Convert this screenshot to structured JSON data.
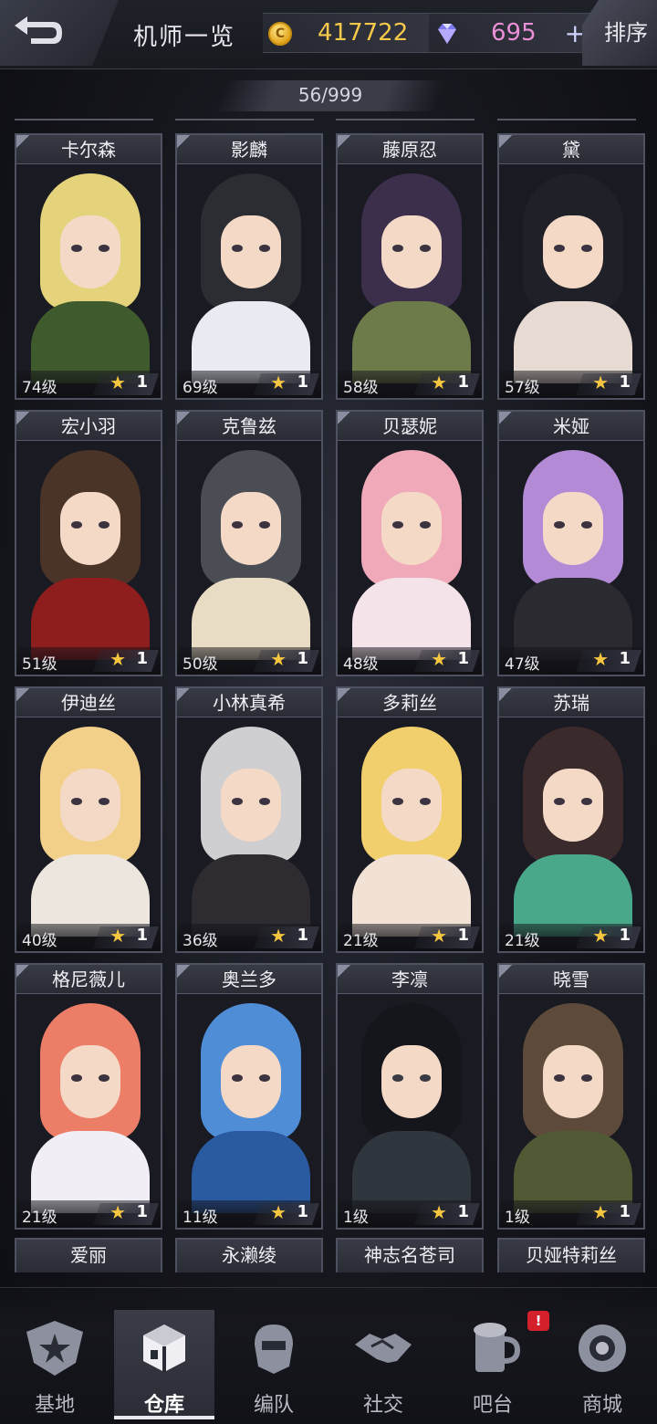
{
  "header": {
    "title": "机师一览",
    "coins": "417722",
    "gems": "695",
    "plus": "+",
    "sort_label": "排序",
    "coin_glyph": "C"
  },
  "count": "56/999",
  "pilots": [
    {
      "name": "卡尔森",
      "level": "74级",
      "rank": "1",
      "hair": "#e4d37a",
      "outfit": "#3f5a2c"
    },
    {
      "name": "影麟",
      "level": "69级",
      "rank": "1",
      "hair": "#2b2d33",
      "outfit": "#e8ecf2"
    },
    {
      "name": "藤原忍",
      "level": "58级",
      "rank": "1",
      "hair": "#3b2f4c",
      "outfit": "#6d7a49"
    },
    {
      "name": "黛",
      "level": "57级",
      "rank": "1",
      "hair": "#1f2028",
      "outfit": "#e6dad2"
    },
    {
      "name": "宏小羽",
      "level": "51级",
      "rank": "1",
      "hair": "#4a3327",
      "outfit": "#8e1d1d"
    },
    {
      "name": "克鲁兹",
      "level": "50级",
      "rank": "1",
      "hair": "#4b4d54",
      "outfit": "#e8dcc4"
    },
    {
      "name": "贝瑟妮",
      "level": "48级",
      "rank": "1",
      "hair": "#f0a9b8",
      "outfit": "#f4e4ea"
    },
    {
      "name": "米娅",
      "level": "47级",
      "rank": "1",
      "hair": "#b28ad6",
      "outfit": "#2b2a31"
    },
    {
      "name": "伊迪丝",
      "level": "40级",
      "rank": "1",
      "hair": "#f2d08a",
      "outfit": "#ece6de"
    },
    {
      "name": "小林真希",
      "level": "36级",
      "rank": "1",
      "hair": "#cfcfd2",
      "outfit": "#2e2c31"
    },
    {
      "name": "多莉丝",
      "level": "21级",
      "rank": "1",
      "hair": "#f0cf6c",
      "outfit": "#f2e2d6"
    },
    {
      "name": "苏瑞",
      "level": "21级",
      "rank": "1",
      "hair": "#3b2a2c",
      "outfit": "#4aa88a"
    },
    {
      "name": "格尼薇儿",
      "level": "21级",
      "rank": "1",
      "hair": "#ec7d66",
      "outfit": "#f2eef6"
    },
    {
      "name": "奥兰多",
      "level": "11级",
      "rank": "1",
      "hair": "#4f8ed6",
      "outfit": "#2a5aa0"
    },
    {
      "name": "李凛",
      "level": "1级",
      "rank": "1",
      "hair": "#15161b",
      "outfit": "#30363e"
    },
    {
      "name": "晓雪",
      "level": "1级",
      "rank": "1",
      "hair": "#5e4a3a",
      "outfit": "#4f5a35"
    }
  ],
  "partial_pilots": [
    "爱丽",
    "永濑绫",
    "神志名苍司",
    "贝娅特莉丝"
  ],
  "nav": [
    {
      "label": "基地",
      "icon": "base-icon"
    },
    {
      "label": "仓库",
      "icon": "warehouse-icon"
    },
    {
      "label": "编队",
      "icon": "squad-icon"
    },
    {
      "label": "社交",
      "icon": "social-icon"
    },
    {
      "label": "吧台",
      "icon": "bar-icon"
    },
    {
      "label": "商城",
      "icon": "shop-icon"
    }
  ],
  "nav_active": "仓库",
  "alert_badge": "!",
  "star_glyph": "★",
  "colors": {
    "coin": "#f5c94a",
    "gem": "#e98fd7",
    "star": "#f7c640",
    "alert": "#d4202a"
  }
}
